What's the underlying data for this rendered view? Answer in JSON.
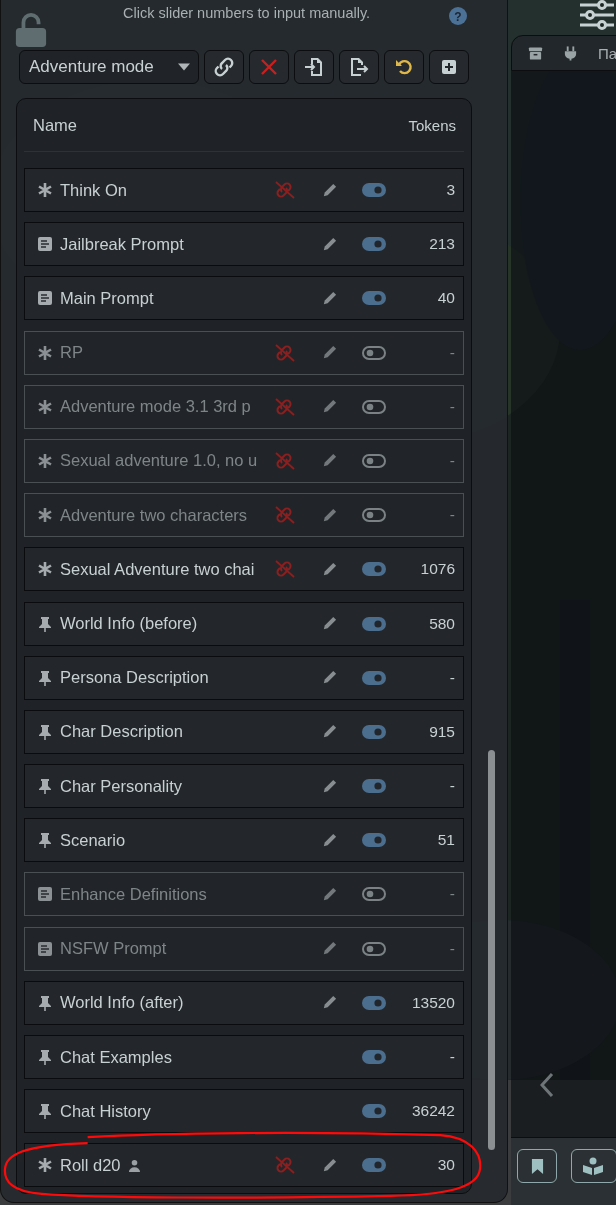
{
  "hint": "Click slider numbers to input manually.",
  "help": {
    "label": "?"
  },
  "preset": {
    "value": "Adventure mode"
  },
  "toolbar": [
    {
      "kind": "link"
    },
    {
      "kind": "delete"
    },
    {
      "kind": "import"
    },
    {
      "kind": "export"
    },
    {
      "kind": "reset"
    },
    {
      "kind": "add"
    }
  ],
  "list": {
    "columns": [
      "Name",
      "Tokens"
    ],
    "rows": [
      {
        "kind": "asterisk",
        "name": "Think On",
        "unlinked": true,
        "editable": true,
        "enabled": true,
        "tokens": "3",
        "user": false,
        "circled": false
      },
      {
        "kind": "document",
        "name": "Jailbreak Prompt",
        "unlinked": false,
        "editable": true,
        "enabled": true,
        "tokens": "213",
        "user": false,
        "circled": false
      },
      {
        "kind": "document",
        "name": "Main Prompt",
        "unlinked": false,
        "editable": true,
        "enabled": true,
        "tokens": "40",
        "user": false,
        "circled": false
      },
      {
        "kind": "asterisk",
        "name": "RP",
        "unlinked": true,
        "editable": true,
        "enabled": false,
        "tokens": "-",
        "user": false,
        "circled": false
      },
      {
        "kind": "asterisk",
        "name": "Adventure mode 3.1 3rd p",
        "unlinked": true,
        "editable": true,
        "enabled": false,
        "tokens": "-",
        "user": false,
        "circled": false
      },
      {
        "kind": "asterisk",
        "name": "Sexual adventure 1.0, no u",
        "unlinked": true,
        "editable": true,
        "enabled": false,
        "tokens": "-",
        "user": false,
        "circled": false
      },
      {
        "kind": "asterisk",
        "name": "Adventure two characters",
        "unlinked": true,
        "editable": true,
        "enabled": false,
        "tokens": "-",
        "user": false,
        "circled": false
      },
      {
        "kind": "asterisk",
        "name": "Sexual Adventure two chai",
        "unlinked": true,
        "editable": true,
        "enabled": true,
        "tokens": "1076",
        "user": false,
        "circled": false
      },
      {
        "kind": "pin",
        "name": "World Info (before)",
        "unlinked": false,
        "editable": true,
        "enabled": true,
        "tokens": "580",
        "user": false,
        "circled": false
      },
      {
        "kind": "pin",
        "name": "Persona Description",
        "unlinked": false,
        "editable": true,
        "enabled": true,
        "tokens": "-",
        "user": false,
        "circled": false
      },
      {
        "kind": "pin",
        "name": "Char Description",
        "unlinked": false,
        "editable": true,
        "enabled": true,
        "tokens": "915",
        "user": false,
        "circled": false
      },
      {
        "kind": "pin",
        "name": "Char Personality",
        "unlinked": false,
        "editable": true,
        "enabled": true,
        "tokens": "-",
        "user": false,
        "circled": false
      },
      {
        "kind": "pin",
        "name": "Scenario",
        "unlinked": false,
        "editable": true,
        "enabled": true,
        "tokens": "51",
        "user": false,
        "circled": false
      },
      {
        "kind": "document",
        "name": "Enhance Definitions",
        "unlinked": false,
        "editable": true,
        "enabled": false,
        "tokens": "-",
        "user": false,
        "circled": false
      },
      {
        "kind": "document",
        "name": "NSFW Prompt",
        "unlinked": false,
        "editable": true,
        "enabled": false,
        "tokens": "-",
        "user": false,
        "circled": false
      },
      {
        "kind": "pin",
        "name": "World Info (after)",
        "unlinked": false,
        "editable": true,
        "enabled": true,
        "tokens": "13520",
        "user": false,
        "circled": false
      },
      {
        "kind": "pin",
        "name": "Chat Examples",
        "unlinked": false,
        "editable": false,
        "enabled": true,
        "tokens": "-",
        "user": false,
        "circled": false
      },
      {
        "kind": "pin",
        "name": "Chat History",
        "unlinked": false,
        "editable": false,
        "enabled": true,
        "tokens": "36242",
        "user": false,
        "circled": false
      },
      {
        "kind": "asterisk",
        "name": "Roll d20",
        "unlinked": true,
        "editable": true,
        "enabled": true,
        "tokens": "30",
        "user": true,
        "circled": true
      }
    ]
  },
  "side_panel": {
    "tab_text": "Па"
  }
}
